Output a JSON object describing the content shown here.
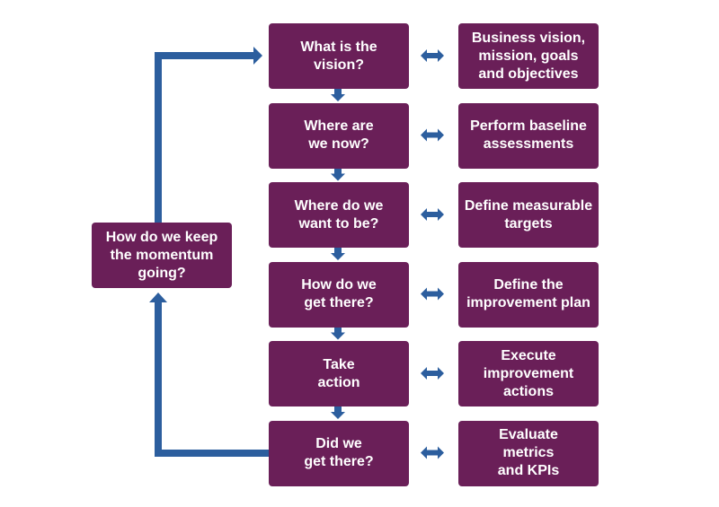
{
  "colors": {
    "box": "#6a1f58",
    "arrow": "#2c5e9e",
    "text": "#ffffff"
  },
  "loop_box": {
    "label": "How do we keep\nthe momentum\ngoing?"
  },
  "steps": [
    {
      "question": "What is the\nvision?",
      "action": "Business vision,\nmission, goals\nand objectives"
    },
    {
      "question": "Where are\nwe now?",
      "action": "Perform baseline\nassessments"
    },
    {
      "question": "Where do we\nwant to be?",
      "action": "Define measurable\ntargets"
    },
    {
      "question": "How do we\nget there?",
      "action": "Define the\nimprovement plan"
    },
    {
      "question": "Take\naction",
      "action": "Execute\nimprovement\nactions"
    },
    {
      "question": "Did we\nget there?",
      "action": "Evaluate\nmetrics\nand KPIs"
    }
  ]
}
